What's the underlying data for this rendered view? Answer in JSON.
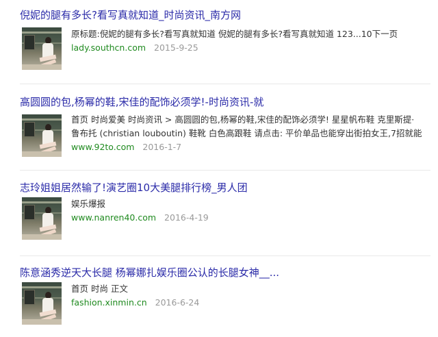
{
  "results": [
    {
      "title": "倪妮的腿有多长?看写真就知道_时尚资讯_南方网",
      "snippet_lines": [
        "原标题:倪妮的腿有多长?看写真就知道 倪妮的腿有多长?看写真就知道 123...10下一页"
      ],
      "url": "lady.southcn.com",
      "date": "2015-9-25"
    },
    {
      "title": "高圆圆的包,杨幂的鞋,宋佳的配饰必须学!-时尚资讯-就",
      "snippet_lines": [
        "首页 时尚爱美 时尚资讯 > 高圆圆的包,杨幂的鞋,宋佳的配饰必须学! 星星帆布鞋 克里斯提·",
        "鲁布托 (christian louboutin) 鞋靴 白色高跟鞋 请点击: 平价单品也能穿出街拍女王,7招就能"
      ],
      "url": "www.92to.com",
      "date": "2016-1-7"
    },
    {
      "title": "志玲姐姐居然输了!演艺圈10大美腿排行榜_男人团",
      "snippet_lines": [
        "娱乐爆报"
      ],
      "url": "www.nanren40.com",
      "date": "2016-4-19"
    },
    {
      "title": "陈意涵秀逆天大长腿 杨幂娜扎娱乐圈公认的长腿女神__...",
      "snippet_lines": [
        "首页 时尚 正文"
      ],
      "url": "fashion.xinmin.cn",
      "date": "2016-6-24"
    }
  ]
}
